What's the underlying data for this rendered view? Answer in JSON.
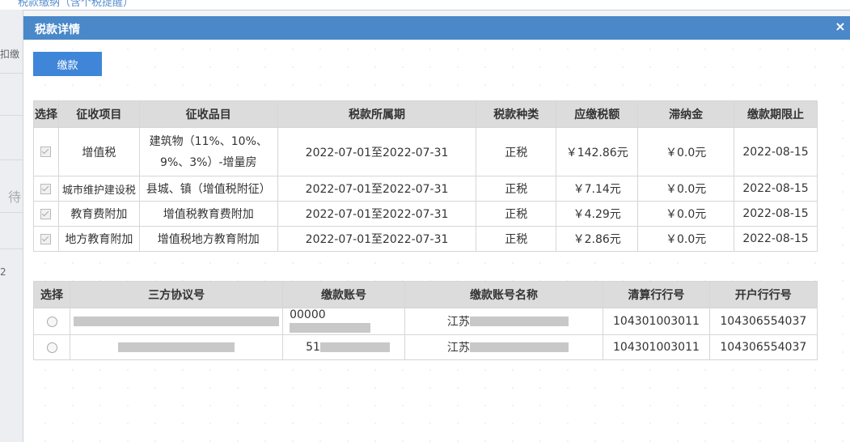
{
  "background": {
    "top_link": "税款缴纳（含个税提醒）",
    "left_fragments": [
      "扣缴",
      "待",
      "2"
    ]
  },
  "modal": {
    "title": "税款详情",
    "close": "×",
    "pay_button": "缴款"
  },
  "tax_table": {
    "headers": [
      "选择",
      "征收项目",
      "征收品目",
      "税款所属期",
      "税款种类",
      "应缴税额",
      "滞纳金",
      "缴款期限止"
    ],
    "rows": [
      {
        "checked": true,
        "item": "增值税",
        "category": "建筑物（11%、10%、9%、3%）-增量房",
        "period": "2022-07-01至2022-07-31",
        "type": "正税",
        "amount": "￥142.86元",
        "late_fee": "￥0.0元",
        "deadline": "2022-08-15"
      },
      {
        "checked": true,
        "item": "城市维护建设税",
        "category": "县城、镇（增值税附征）",
        "period": "2022-07-01至2022-07-31",
        "type": "正税",
        "amount": "￥7.14元",
        "late_fee": "￥0.0元",
        "deadline": "2022-08-15"
      },
      {
        "checked": true,
        "item": "教育费附加",
        "category": "增值税教育费附加",
        "period": "2022-07-01至2022-07-31",
        "type": "正税",
        "amount": "￥4.29元",
        "late_fee": "￥0.0元",
        "deadline": "2022-08-15"
      },
      {
        "checked": true,
        "item": "地方教育附加",
        "category": "增值税地方教育附加",
        "period": "2022-07-01至2022-07-31",
        "type": "正税",
        "amount": "￥2.86元",
        "late_fee": "￥0.0元",
        "deadline": "2022-08-15"
      }
    ]
  },
  "account_table": {
    "headers": [
      "选择",
      "三方协议号",
      "缴款账号",
      "缴款账号名称",
      "清算行行号",
      "开户行行号"
    ],
    "rows": [
      {
        "selected": false,
        "agreement": "",
        "account": "00000",
        "account_name": "江苏",
        "clearing_bank": "104301003011",
        "opening_bank": "104306554037"
      },
      {
        "selected": false,
        "agreement": "",
        "account": "51",
        "account_name": "江苏",
        "clearing_bank": "104301003011",
        "opening_bank": "104306554037"
      }
    ]
  }
}
